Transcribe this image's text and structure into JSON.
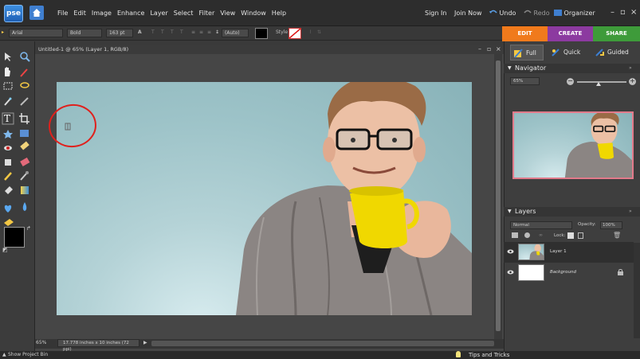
{
  "app": {
    "logo_text": "pse"
  },
  "menubar": {
    "items": [
      "File",
      "Edit",
      "Image",
      "Enhance",
      "Layer",
      "Select",
      "Filter",
      "View",
      "Window",
      "Help"
    ],
    "sign_in": "Sign In",
    "join_now": "Join Now",
    "undo": "Undo",
    "redo": "Redo",
    "organizer": "Organizer"
  },
  "options": {
    "font_family": "Arial",
    "font_style": "Bold",
    "font_size": "163 pt",
    "leading": "(Auto)",
    "style_label": "Style"
  },
  "modes": {
    "edit": "EDIT",
    "create": "CREATE",
    "share": "SHARE"
  },
  "document": {
    "title": "Untitled-1 @ 65% (Layer 1, RGB/8)",
    "zoom": "65%",
    "info": "17.778 inches x 10 inches (72 ppi)"
  },
  "subtabs": {
    "full": "Full",
    "quick": "Quick",
    "guided": "Guided"
  },
  "navigator": {
    "title": "Navigator",
    "zoom": "65%"
  },
  "layers": {
    "title": "Layers",
    "blend_mode": "Normal",
    "opacity_label": "Opacity:",
    "opacity": "100%",
    "lock_label": "Lock:",
    "items": [
      {
        "name": "Layer 1"
      },
      {
        "name": "Background"
      }
    ]
  },
  "bottom": {
    "project_bin": "Show Project Bin",
    "tips": "Tips and Tricks"
  },
  "colors": {
    "edit": "#f07a1c",
    "create": "#8c3aa0",
    "share": "#3e9b3a",
    "annotation": "#e0201c"
  }
}
